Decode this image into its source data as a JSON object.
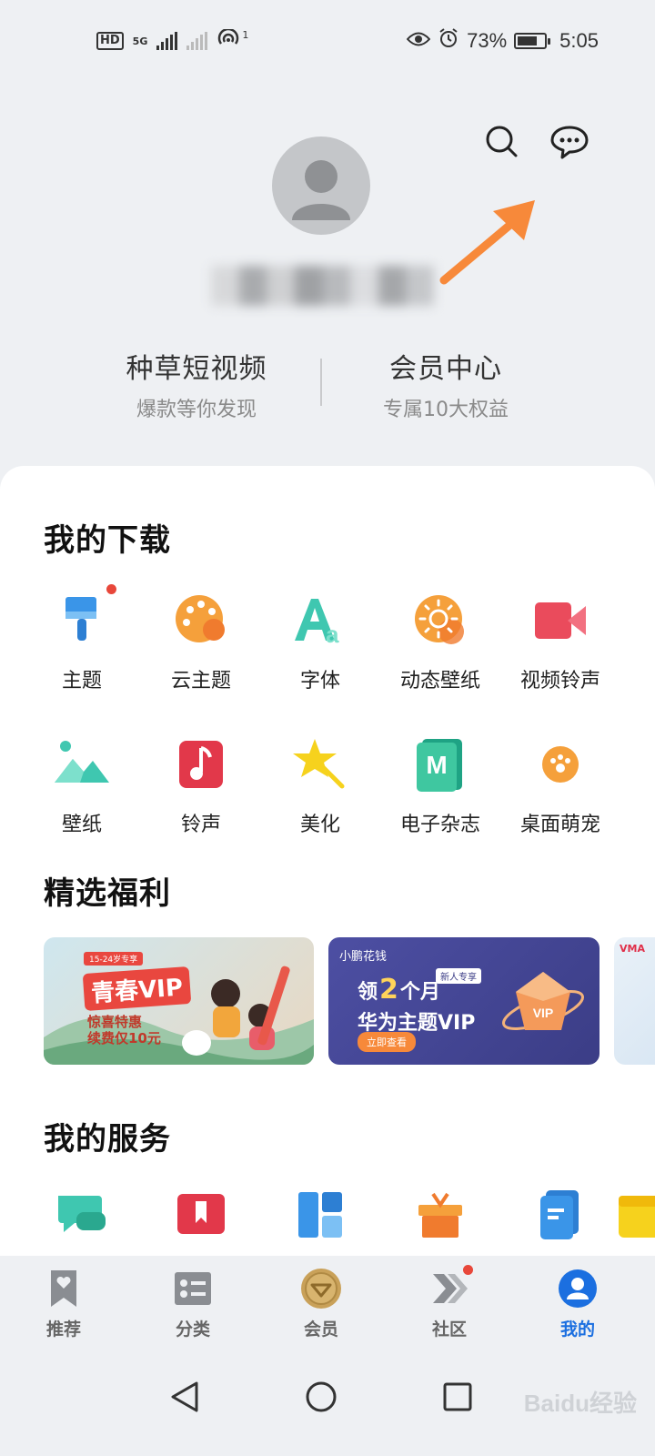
{
  "status_bar": {
    "left_badge": "HD",
    "network_label": "5G",
    "hotspot_count": "1",
    "battery_percent": "73%",
    "battery_level": 0.73,
    "time": "5:05"
  },
  "header": {
    "search_icon": "search-icon",
    "message_icon": "message-icon"
  },
  "quick_links": [
    {
      "title": "种草短视频",
      "subtitle": "爆款等你发现"
    },
    {
      "title": "会员中心",
      "subtitle": "专属10大权益"
    }
  ],
  "downloads": {
    "title": "我的下载",
    "items": [
      {
        "label": "主题",
        "icon": "brush-icon"
      },
      {
        "label": "云主题",
        "icon": "palette-icon"
      },
      {
        "label": "字体",
        "icon": "font-icon"
      },
      {
        "label": "动态壁纸",
        "icon": "sun-icon"
      },
      {
        "label": "视频铃声",
        "icon": "video-camera-icon"
      },
      {
        "label": "壁纸",
        "icon": "landscape-icon"
      },
      {
        "label": "铃声",
        "icon": "music-note-icon"
      },
      {
        "label": "美化",
        "icon": "magic-wand-icon"
      },
      {
        "label": "电子杂志",
        "icon": "magazine-icon"
      },
      {
        "label": "桌面萌宠",
        "icon": "paw-icon"
      }
    ]
  },
  "benefits": {
    "title": "精选福利",
    "banners": [
      {
        "tag": "15-24岁专享",
        "headline": "青春VIP",
        "subline_1": "惊喜特惠",
        "subline_2": "续费仅10元"
      },
      {
        "brand": "小鹏花钱",
        "tag": "新人专享",
        "line_1_pre": "领",
        "line_1_num": "2",
        "line_1_post": "个月",
        "line_2": "华为主题VIP",
        "cta": "立即查看"
      },
      {
        "brand": "VMA"
      }
    ]
  },
  "services": {
    "title": "我的服务",
    "icons": [
      "chat-icon",
      "bookmark-icon",
      "layout-icon",
      "gift-icon",
      "document-icon",
      "calendar-icon"
    ]
  },
  "bottom_nav": [
    {
      "label": "推荐",
      "icon": "heart-bookmark-icon"
    },
    {
      "label": "分类",
      "icon": "list-icon"
    },
    {
      "label": "会员",
      "icon": "vip-coin-icon"
    },
    {
      "label": "社区",
      "icon": "chevrons-icon"
    },
    {
      "label": "我的",
      "icon": "user-icon",
      "active": true
    }
  ],
  "system_nav": [
    "back-icon",
    "home-icon",
    "recents-icon"
  ],
  "watermark": "Baidu经验",
  "colors": {
    "accent": "#1b6fe0",
    "arrow": "#f7893a",
    "badge": "#e8473a"
  }
}
